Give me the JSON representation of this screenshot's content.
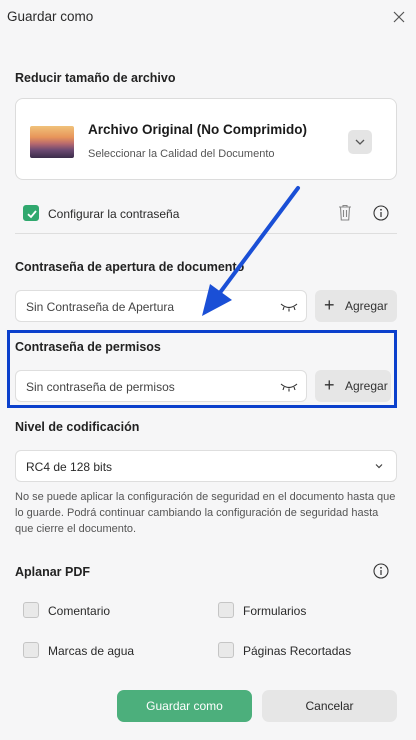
{
  "dialog": {
    "title": "Guardar como"
  },
  "compress": {
    "heading": "Reducir tamaño de archivo",
    "option_title": "Archivo Original (No Comprimido)",
    "option_subtitle": "Seleccionar la Calidad del Documento"
  },
  "password": {
    "configure_label": "Configurar la contraseña",
    "configure_checked": true,
    "open_heading": "Contraseña de apertura de documento",
    "open_placeholder": "Sin Contraseña de Apertura",
    "open_add_label": "Agregar",
    "perm_heading": "Contraseña de permisos",
    "perm_placeholder": "Sin contraseña de permisos",
    "perm_add_label": "Agregar"
  },
  "encryption": {
    "heading": "Nivel de codificación",
    "selected": "RC4 de 128 bits",
    "note": "No se puede aplicar la configuración de seguridad en el documento hasta que lo guarde. Podrá continuar cambiando la configuración de seguridad hasta que cierre el documento."
  },
  "flatten": {
    "heading": "Aplanar PDF",
    "options": [
      "Comentario",
      "Formularios",
      "Marcas de agua",
      "Páginas Recortadas"
    ]
  },
  "footer": {
    "save_label": "Guardar como",
    "cancel_label": "Cancelar"
  },
  "colors": {
    "accent": "#4caf7c",
    "highlight": "#0b40cc",
    "annotation_arrow": "#1a4fd6"
  }
}
